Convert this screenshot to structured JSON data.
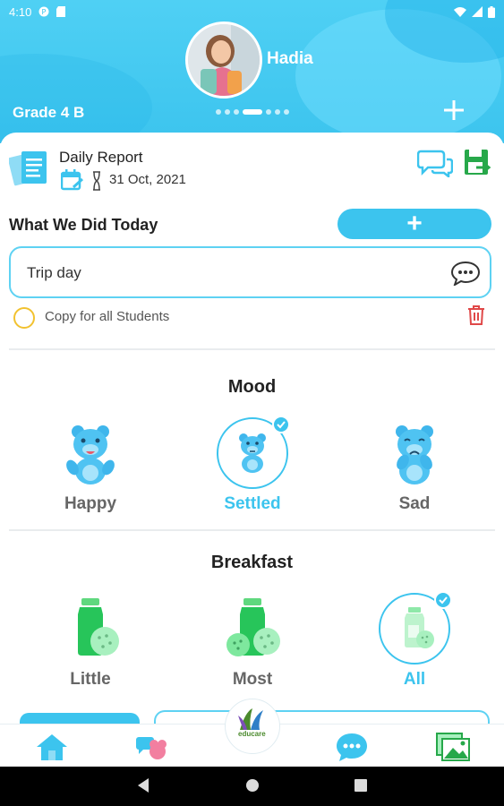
{
  "status_bar": {
    "time": "4:10",
    "left_icons": [
      "app-notification-icon",
      "sd-card-icon"
    ],
    "right_icons": [
      "wifi-icon",
      "signal-icon",
      "battery-icon"
    ]
  },
  "header": {
    "student_name": "Hadia",
    "class_label": "Grade 4 B",
    "pager_active_index": 3,
    "pager_count": 7,
    "add_icon": "plus-icon"
  },
  "report": {
    "title": "Daily Report",
    "date": "31 Oct, 2021",
    "icons": [
      "documents-icon",
      "calendar-icon",
      "chat-bubbles-icon",
      "save-export-icon"
    ]
  },
  "activity": {
    "section_label": "What We Did Today",
    "add_button_label": "+",
    "input_value": "Trip day",
    "copy_label": "Copy for all Students",
    "copy_checked": false
  },
  "mood": {
    "title": "Mood",
    "options": [
      {
        "label": "Happy",
        "selected": false
      },
      {
        "label": "Settled",
        "selected": true
      },
      {
        "label": "Sad",
        "selected": false
      }
    ]
  },
  "breakfast": {
    "title": "Breakfast",
    "options": [
      {
        "label": "Little",
        "selected": false
      },
      {
        "label": "Most",
        "selected": false
      },
      {
        "label": "All",
        "selected": true
      }
    ]
  },
  "bottom_nav": {
    "logo_text": "educare",
    "items": [
      "home-icon",
      "classes-icon",
      "messages-icon",
      "gallery-icon"
    ]
  },
  "colors": {
    "accent": "#3cc4ee",
    "green": "#27a84a",
    "checkbox": "#f2c230",
    "trash": "#e04848"
  }
}
